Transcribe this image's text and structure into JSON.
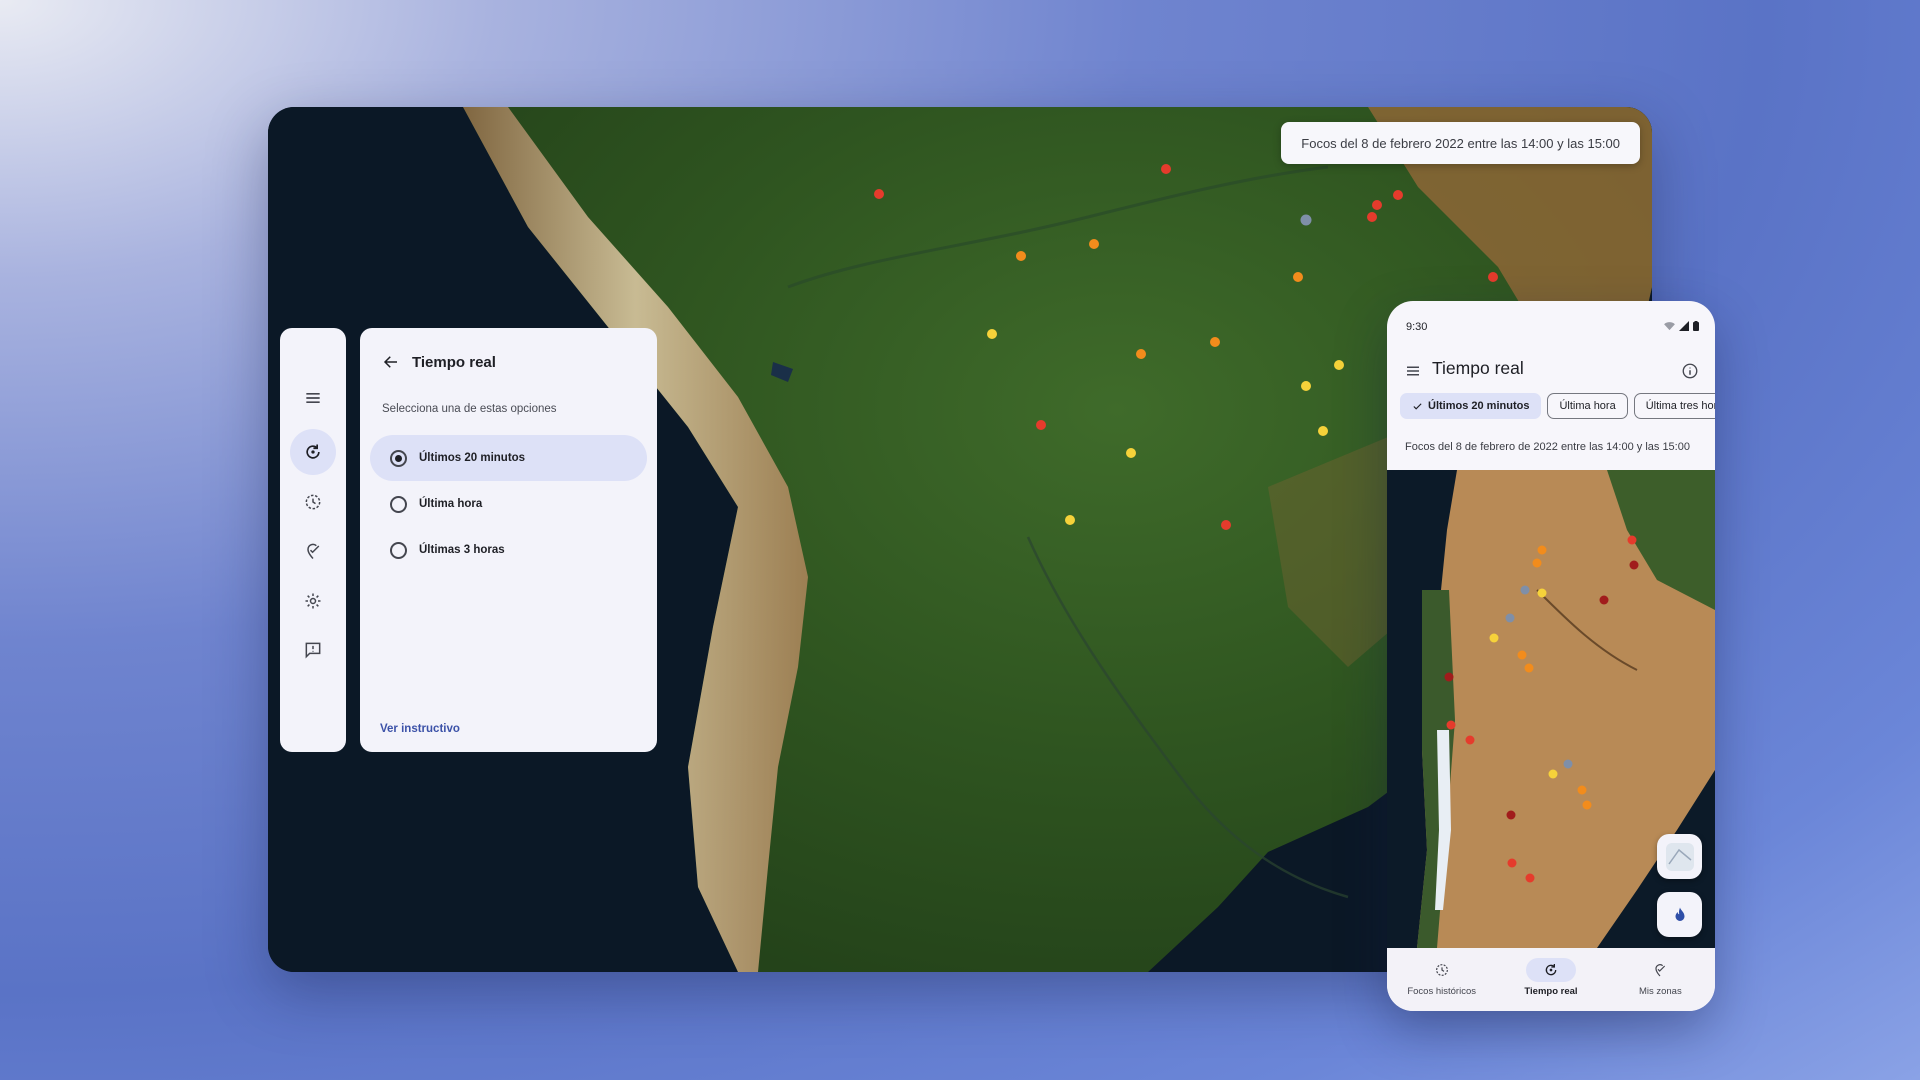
{
  "desktop": {
    "banner_text": "Focos del 8 de febrero 2022 entre las 14:00 y las 15:00",
    "rail": {
      "items": [
        {
          "icon": "menu-icon"
        },
        {
          "icon": "realtime-icon",
          "active": true
        },
        {
          "icon": "history-clock-icon"
        },
        {
          "icon": "my-zones-icon"
        },
        {
          "icon": "gear-icon"
        },
        {
          "icon": "feedback-icon"
        }
      ]
    },
    "panel": {
      "title": "Tiempo real",
      "subtitle": "Selecciona una de estas opciones",
      "options": [
        {
          "label": "Últimos 20 minutos",
          "selected": true
        },
        {
          "label": "Última hora",
          "selected": false
        },
        {
          "label": "Últimas 3 horas",
          "selected": false
        }
      ],
      "link": "Ver instructivo"
    }
  },
  "phone": {
    "status_time": "9:30",
    "title": "Tiempo real",
    "chips": [
      {
        "label": "Últimos 20 minutos",
        "selected": true
      },
      {
        "label": "Última hora",
        "selected": false
      },
      {
        "label": "Última tres horas",
        "selected": false
      }
    ],
    "banner_text": "Focos del 8 de febrero de 2022 entre las 14:00 y las 15:00",
    "fabs": [
      {
        "icon": "map-layers-icon"
      },
      {
        "icon": "fire-icon"
      }
    ],
    "bottom_nav": [
      {
        "label": "Focos históricos",
        "icon": "history-clock-icon",
        "active": false
      },
      {
        "label": "Tiempo real",
        "icon": "realtime-icon",
        "active": true
      },
      {
        "label": "Mis zonas",
        "icon": "my-zones-icon",
        "active": false
      }
    ]
  },
  "colors": {
    "accent": "#dde1f7",
    "link": "#3c52a8",
    "fire_red": "#e53b2c",
    "fire_orange": "#f28c1c",
    "fire_yellow": "#f6d23a",
    "fire_gray": "#7f8fa8",
    "fire_darkred": "#a11c1c"
  }
}
